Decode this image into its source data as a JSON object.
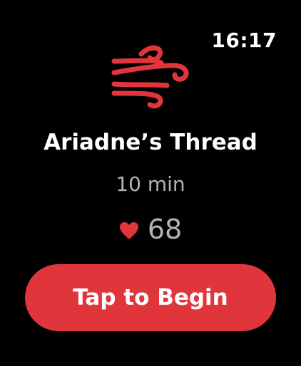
{
  "status_bar": {
    "time": "16:17"
  },
  "session": {
    "icon": "breathe-wind-icon",
    "title": "Ariadne’s Thread",
    "duration": "10 min",
    "heart_icon": "heart-icon",
    "heart_rate": "68"
  },
  "action": {
    "begin_label": "Tap to Begin"
  },
  "colors": {
    "accent": "#e0363b",
    "secondary_text": "#b3b3b3",
    "background": "#000000"
  }
}
